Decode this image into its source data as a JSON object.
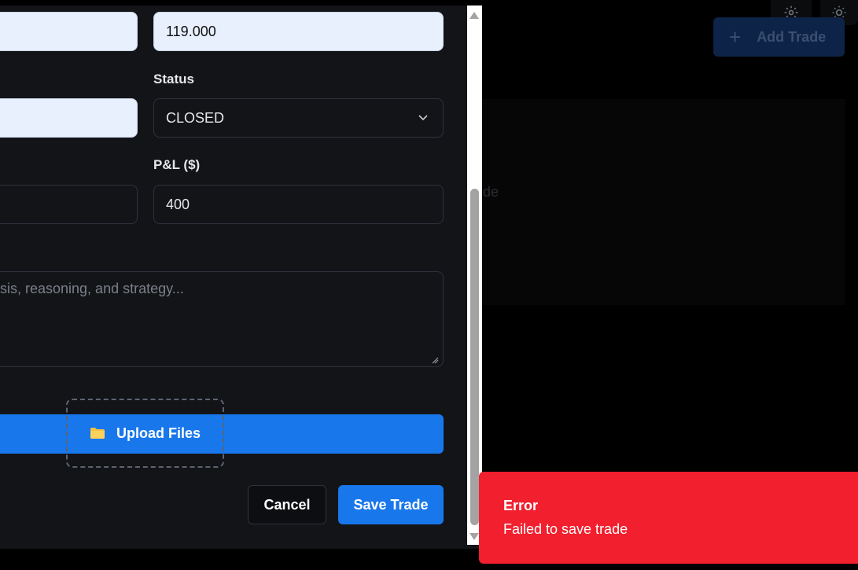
{
  "background": {
    "add_trade_label": "Add Trade",
    "add_trade_icon": "plus-icon",
    "partial_text": "de",
    "icons": [
      "gear-icon",
      "sun-icon"
    ]
  },
  "form": {
    "top_right_value": "119.000",
    "status": {
      "label": "Status",
      "value": "CLOSED",
      "icon": "chevron-down-icon"
    },
    "pnl": {
      "label": "P&L ($)",
      "value": "400"
    },
    "notes": {
      "placeholder": "sis, reasoning, and strategy..."
    },
    "upload": {
      "label": "Upload Files",
      "icon": "folder-icon"
    },
    "buttons": {
      "cancel": "Cancel",
      "save": "Save Trade"
    }
  },
  "toast": {
    "title": "Error",
    "message": "Failed to save trade",
    "color": "#f21f2e"
  },
  "colors": {
    "accent": "#1877ea",
    "modal_bg": "#131418",
    "autofill_bg": "#e8f0fe"
  }
}
